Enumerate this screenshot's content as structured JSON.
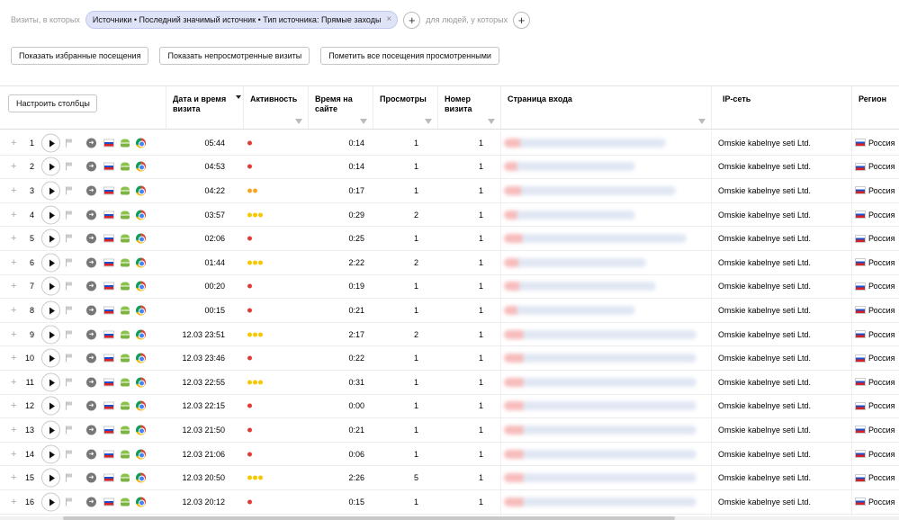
{
  "filter": {
    "prefix": "Визиты, в которых",
    "chip": "Источники • Последний значимый источник • Тип источника: Прямые заходы",
    "chip_close": "×",
    "add": "+",
    "people_label": "для людей, у которых"
  },
  "actions": {
    "show_favorites": "Показать избранные посещения",
    "show_unviewed": "Показать непросмотренные визиты",
    "mark_all_viewed": "Пометить все посещения просмотренными"
  },
  "table": {
    "configure_columns": "Настроить столбцы",
    "columns": {
      "datetime": "Дата и время визита",
      "activity": "Активность",
      "time_on_site": "Время на сайте",
      "views": "Просмотры",
      "visit_number": "Номер визита",
      "entry_page": "Страница входа",
      "ip_network": "IP-сеть",
      "region": "Регион"
    },
    "rows": [
      {
        "n": "1",
        "datetime": "05:44",
        "activity": 1,
        "activity_color": "#e53935",
        "time": "0:14",
        "views": "1",
        "visit": "1",
        "ip": "Omskie kabelnye seti Ltd.",
        "region": "Россия",
        "bar": 0.8
      },
      {
        "n": "2",
        "datetime": "04:53",
        "activity": 1,
        "activity_color": "#e53935",
        "time": "0:14",
        "views": "1",
        "visit": "1",
        "ip": "Omskie kabelnye seti Ltd.",
        "region": "Россия",
        "bar": 0.65
      },
      {
        "n": "3",
        "datetime": "04:22",
        "activity": 2,
        "activity_color": "#f5a623",
        "time": "0:17",
        "views": "1",
        "visit": "1",
        "ip": "Omskie kabelnye seti Ltd.",
        "region": "Россия",
        "bar": 0.85
      },
      {
        "n": "4",
        "datetime": "03:57",
        "activity": 3,
        "activity_color": "#f7c800",
        "time": "0:29",
        "views": "2",
        "visit": "1",
        "ip": "Omskie kabelnye seti Ltd.",
        "region": "Россия",
        "bar": 0.65
      },
      {
        "n": "5",
        "datetime": "02:06",
        "activity": 1,
        "activity_color": "#e53935",
        "time": "0:25",
        "views": "1",
        "visit": "1",
        "ip": "Omskie kabelnye seti Ltd.",
        "region": "Россия",
        "bar": 0.9
      },
      {
        "n": "6",
        "datetime": "01:44",
        "activity": 3,
        "activity_color": "#f7c800",
        "time": "2:22",
        "views": "2",
        "visit": "1",
        "ip": "Omskie kabelnye seti Ltd.",
        "region": "Россия",
        "bar": 0.7
      },
      {
        "n": "7",
        "datetime": "00:20",
        "activity": 1,
        "activity_color": "#e53935",
        "time": "0:19",
        "views": "1",
        "visit": "1",
        "ip": "Omskie kabelnye seti Ltd.",
        "region": "Россия",
        "bar": 0.75
      },
      {
        "n": "8",
        "datetime": "00:15",
        "activity": 1,
        "activity_color": "#e53935",
        "time": "0:21",
        "views": "1",
        "visit": "1",
        "ip": "Omskie kabelnye seti Ltd.",
        "region": "Россия",
        "bar": 0.65
      },
      {
        "n": "9",
        "datetime": "12.03 23:51",
        "activity": 3,
        "activity_color": "#f7c800",
        "time": "2:17",
        "views": "2",
        "visit": "1",
        "ip": "Omskie kabelnye seti Ltd.",
        "region": "Россия",
        "bar": 0.95
      },
      {
        "n": "10",
        "datetime": "12.03 23:46",
        "activity": 1,
        "activity_color": "#e53935",
        "time": "0:22",
        "views": "1",
        "visit": "1",
        "ip": "Omskie kabelnye seti Ltd.",
        "region": "Россия",
        "bar": 0.95
      },
      {
        "n": "11",
        "datetime": "12.03 22:55",
        "activity": 3,
        "activity_color": "#f7c800",
        "time": "0:31",
        "views": "1",
        "visit": "1",
        "ip": "Omskie kabelnye seti Ltd.",
        "region": "Россия",
        "bar": 0.95
      },
      {
        "n": "12",
        "datetime": "12.03 22:15",
        "activity": 1,
        "activity_color": "#e53935",
        "time": "0:00",
        "views": "1",
        "visit": "1",
        "ip": "Omskie kabelnye seti Ltd.",
        "region": "Россия",
        "bar": 0.95
      },
      {
        "n": "13",
        "datetime": "12.03 21:50",
        "activity": 1,
        "activity_color": "#e53935",
        "time": "0:21",
        "views": "1",
        "visit": "1",
        "ip": "Omskie kabelnye seti Ltd.",
        "region": "Россия",
        "bar": 0.95
      },
      {
        "n": "14",
        "datetime": "12.03 21:06",
        "activity": 1,
        "activity_color": "#e53935",
        "time": "0:06",
        "views": "1",
        "visit": "1",
        "ip": "Omskie kabelnye seti Ltd.",
        "region": "Россия",
        "bar": 0.95
      },
      {
        "n": "15",
        "datetime": "12.03 20:50",
        "activity": 3,
        "activity_color": "#f7c800",
        "time": "2:26",
        "views": "5",
        "visit": "1",
        "ip": "Omskie kabelnye seti Ltd.",
        "region": "Россия",
        "bar": 0.95
      },
      {
        "n": "16",
        "datetime": "12.03 20:12",
        "activity": 1,
        "activity_color": "#e53935",
        "time": "0:15",
        "views": "1",
        "visit": "1",
        "ip": "Omskie kabelnye seti Ltd.",
        "region": "Россия",
        "bar": 0.95
      }
    ]
  }
}
